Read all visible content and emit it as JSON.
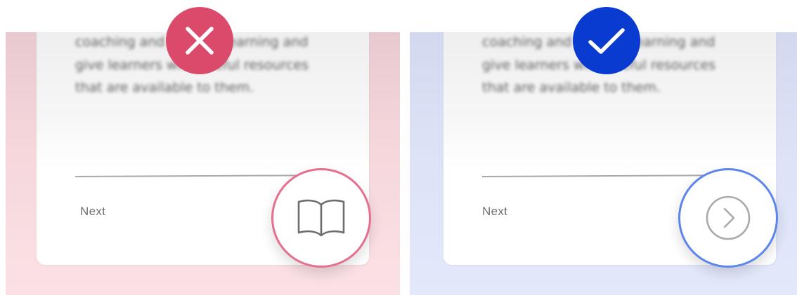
{
  "colors": {
    "bad_accent": "#db4a6b",
    "bad_ring": "#e66f8e",
    "bad_background": "#fbe1e5",
    "good_accent": "#0a3bd0",
    "good_ring": "#5c86ec",
    "good_background": "#e3e8fb"
  },
  "bad_example": {
    "badge_icon": "close-icon",
    "card_text": "coaching and content learning and give learners with useful resources that are available to them.",
    "next_label": "Next",
    "fab_icon": "open-book-icon"
  },
  "good_example": {
    "badge_icon": "checkmark-icon",
    "card_text": "coaching and content learning and give learners with useful resources that are available to them.",
    "next_label": "Next",
    "fab_icon": "chevron-right-circle-icon"
  }
}
